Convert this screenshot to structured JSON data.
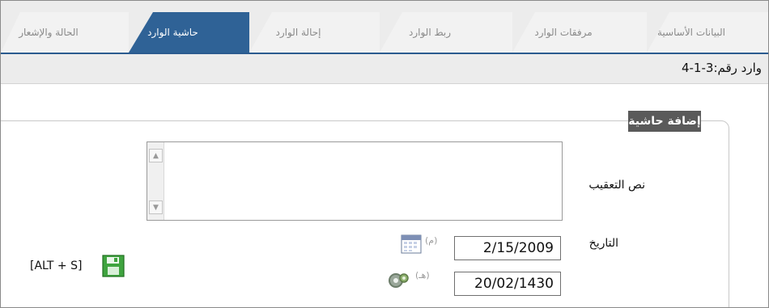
{
  "tabs": [
    {
      "label": "البيانات الأساسية",
      "active": false
    },
    {
      "label": "مرفقات الوارد",
      "active": false
    },
    {
      "label": "ربط الوارد",
      "active": false
    },
    {
      "label": "إحالة الوارد",
      "active": false
    },
    {
      "label": "حاشية الوارد",
      "active": true
    },
    {
      "label": "الحالة والإشعار",
      "active": false
    }
  ],
  "record": {
    "label": "وارد رقم:",
    "number": "3-1-4"
  },
  "section": {
    "legend": "إضافة حاشية"
  },
  "form": {
    "comment_label": "نص التعقيب",
    "comment_value": "",
    "date_label": "التاريخ",
    "gregorian_date": "2/15/2009",
    "hijri_date": "20/02/1430",
    "gregorian_marker": "(م)",
    "hijri_marker": "(هـ)"
  },
  "actions": {
    "save_shortcut": "[ALT + S]"
  },
  "icons": {
    "calendar": "calendar-icon",
    "gear": "gear-icon",
    "save": "floppy-disk-icon"
  },
  "colors": {
    "active_tab": "#2f6296",
    "legend_bg": "#5a5a5a",
    "save_green": "#2ca02c"
  }
}
